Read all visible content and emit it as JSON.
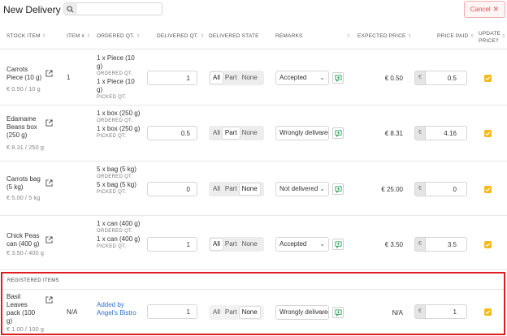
{
  "header": {
    "title": "New Delivery",
    "search_placeholder": "",
    "cancel_label": "Cancel",
    "cancel_icon": "✕"
  },
  "columns": {
    "stock_item": "STOCK ITEM",
    "item_no": "ITEM #",
    "ordered_qt": "ORDERED QT.",
    "delivered_qt": "DELIVERED QT.",
    "delivered_state": "DELIVERED STATE",
    "remarks": "REMARKS",
    "expected_price": "EXPECTED PRICE",
    "price_paid": "PRICE PAID",
    "update_price_1": "UPDATE",
    "update_price_2": "PRICE?",
    "sort_icon": "⇕"
  },
  "labels": {
    "ordered": "ORDERED QT.",
    "picked": "PICKED QT.",
    "state_all": "All",
    "state_part": "Part",
    "state_none": "None",
    "currency": "€"
  },
  "rows": [
    {
      "name": "Carrots Piece (10 g)",
      "unit_price": "€ 0.50 / 10 g",
      "item_no": "1",
      "ordered": "1 x Piece (10 g)",
      "picked": "1 x Piece (10 g)",
      "delivered_qt": "1",
      "state": "All",
      "remark": "Accepted",
      "expected": "€ 0.50",
      "price_paid": "0.5",
      "update_price": true
    },
    {
      "name": "Edamame Beans box (250 g)",
      "unit_price": "€ 8.31 / 250 g",
      "item_no": "",
      "ordered": "1 x box (250 g)",
      "picked": "1 x box (250 g)",
      "delivered_qt": "0.5",
      "state": "Part",
      "remark": "Wrongly delivered",
      "expected": "€ 8.31",
      "price_paid": "4.16",
      "update_price": true
    },
    {
      "name": "Carrots bag (5 kg)",
      "unit_price": "€ 5.00 / 5 kg",
      "item_no": "",
      "ordered": "5 x bag (5 kg)",
      "picked": "5 x bag (5 kg)",
      "delivered_qt": "0",
      "state": "None",
      "remark": "Not delivered",
      "expected": "€ 25.00",
      "price_paid": "0",
      "update_price": true
    },
    {
      "name": "Chick Peas can (400 g)",
      "unit_price": "€ 3.50 / 400 g",
      "item_no": "",
      "ordered": "1 x can (400 g)",
      "picked": "1 x can (400 g)",
      "delivered_qt": "1",
      "state": "All",
      "remark": "Accepted",
      "expected": "€ 3.50",
      "price_paid": "3.5",
      "update_price": true
    }
  ],
  "registered": {
    "heading": "REGISTERED ITEMS",
    "name": "Basil Leaves pack (100 g)",
    "unit_price": "€ 1.00 / 100 g",
    "item_no": "N/A",
    "added_by": "Added by Angel's Bistro",
    "delivered_qt": "1",
    "state": "None",
    "remark": "Wrongly delivered",
    "expected": "N/A",
    "price_paid": "1",
    "update_price": true
  },
  "colors": {
    "accent": "#f5b917",
    "cancel": "#e34b52",
    "highlight_border": "#e11b22",
    "link": "#2f6fd6"
  }
}
